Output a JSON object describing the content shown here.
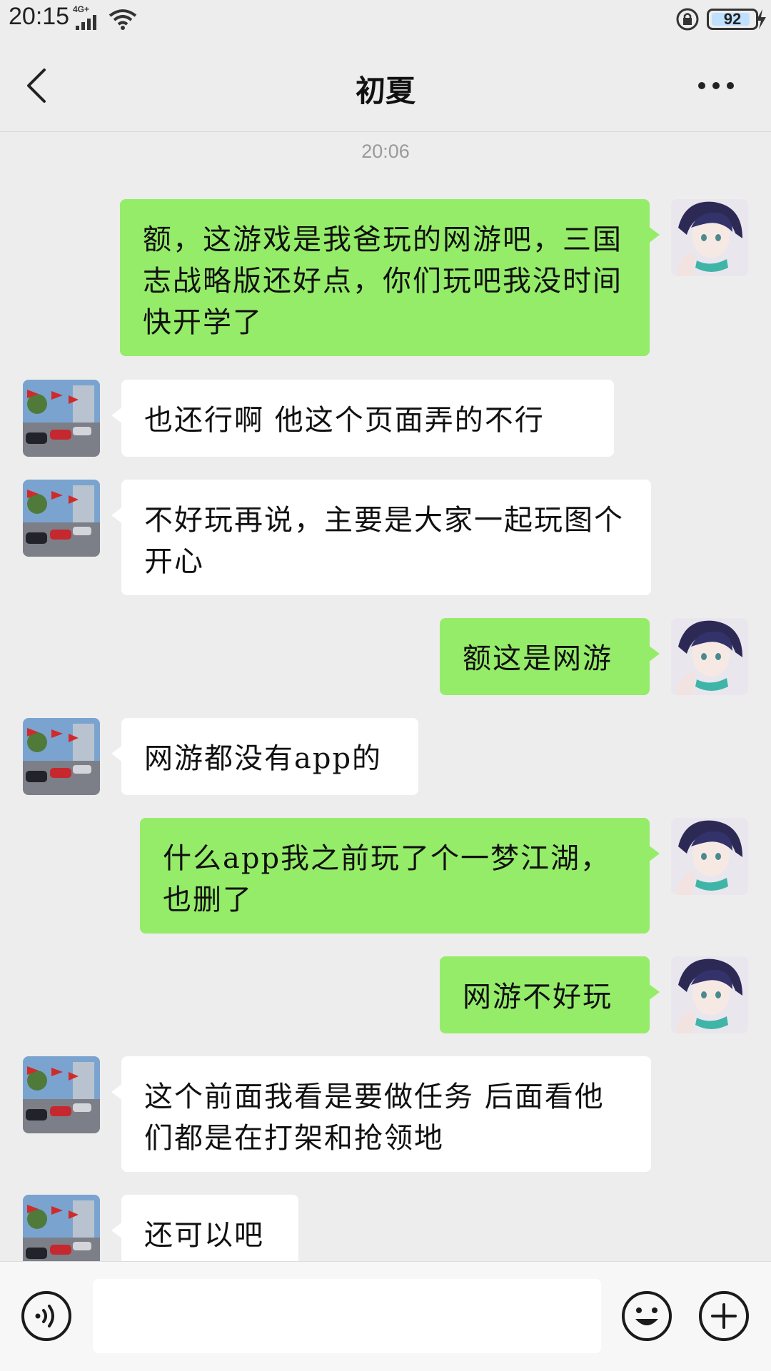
{
  "status_bar": {
    "time": "20:15",
    "network": "4G+",
    "battery": "92",
    "battery_level": 0.92
  },
  "header": {
    "title": "初夏",
    "back_icon": "chevron-left-icon",
    "more_icon": "more-dots-icon"
  },
  "chat": {
    "timestamp": "20:06",
    "messages": [
      {
        "sender": "me",
        "text": "额，这游戏是我爸玩的网游吧，三国志战略版还好点，你们玩吧我没时间快开学了"
      },
      {
        "sender": "other",
        "text": "也还行啊  他这个页面弄的不行"
      },
      {
        "sender": "other",
        "text": "不好玩再说，主要是大家一起玩图个开心"
      },
      {
        "sender": "me",
        "text": "额这是网游"
      },
      {
        "sender": "other",
        "text": "网游都没有app的"
      },
      {
        "sender": "me",
        "text": "什么app我之前玩了个一梦江湖，也删了"
      },
      {
        "sender": "me",
        "text": "网游不好玩"
      },
      {
        "sender": "other",
        "text": "这个前面我看是要做任务 后面看他们都是在打架和抢领地"
      },
      {
        "sender": "other",
        "text": "还可以吧"
      }
    ]
  },
  "input_bar": {
    "voice_icon": "voice-icon",
    "input_value": "",
    "emoji_icon": "emoji-icon",
    "plus_icon": "plus-icon"
  },
  "colors": {
    "background": "#ededed",
    "my_bubble": "#95ec69",
    "other_bubble": "#ffffff",
    "timestamp": "#9a9a9a"
  }
}
